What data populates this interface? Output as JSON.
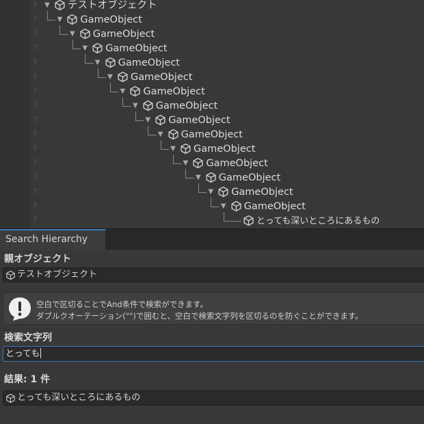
{
  "hierarchy": {
    "row_marker": "E",
    "root": "テストオブジェクト",
    "children": [
      "GameObject",
      "GameObject",
      "GameObject",
      "GameObject",
      "GameObject",
      "GameObject",
      "GameObject",
      "GameObject",
      "GameObject",
      "GameObject",
      "GameObject",
      "GameObject",
      "GameObject",
      "GameObject"
    ],
    "leaf": "とっても深いところにあるもの"
  },
  "search_window": {
    "tab_title": "Search Hierarchy",
    "parent_label": "親オブジェクト",
    "parent_value": "テストオブジェクト",
    "help": {
      "line1": "空白で区切ることでAnd条件で検索ができます。",
      "line2": "ダブルクオーテーション(\"\")で囲むと、空白で検索文字列を区切るのを防ぐことができます。"
    },
    "search_label": "検索文字列",
    "search_value": "とっても",
    "results_label": "結果: 1 件",
    "results": [
      "とっても深いところにあるもの"
    ]
  },
  "colors": {
    "background": "#383838",
    "field": "#2a2a2a",
    "accent": "#3a79bb",
    "text": "#d2d2d2"
  },
  "icons": {
    "object": "cube-icon",
    "foldout": "triangle-down-icon",
    "warning": "exclamation-bubble-icon"
  }
}
